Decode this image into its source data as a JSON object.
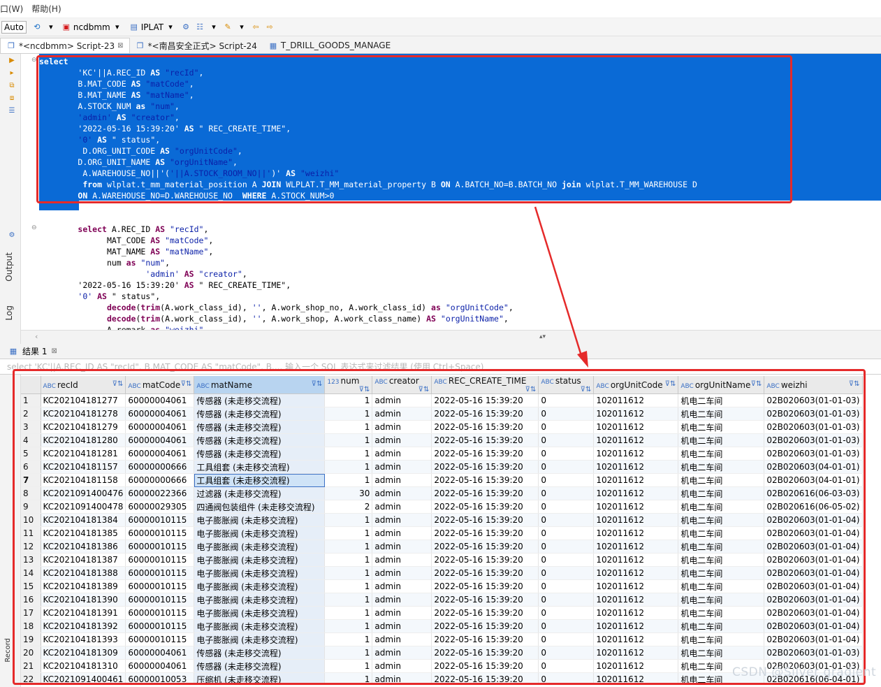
{
  "menu": {
    "window": "口(W)",
    "help": "帮助(H)"
  },
  "toolbar": {
    "auto": "Auto",
    "connection": "ncdbmm",
    "schema": "IPLAT"
  },
  "tabs": [
    {
      "label": "*<ncdbmm> Script-23",
      "close": "⊠"
    },
    {
      "label": "*<南昌安全正式> Script-24",
      "close": ""
    },
    {
      "label": "T_DRILL_GOODS_MANAGE",
      "close": ""
    }
  ],
  "side": {
    "output": "Output",
    "log": "Log",
    "record": "Record"
  },
  "editor": {
    "selected_lines": [
      "select",
      "        'KC'||A.REC_ID AS \"recId\",",
      "        B.MAT_CODE AS \"matCode\",",
      "        B.MAT_NAME AS \"matName\",",
      "        A.STOCK_NUM as \"num\",",
      "        'admin' AS \"creator\",",
      "        '2022-05-16 15:39:20' AS \" REC_CREATE_TIME\",",
      "        '0' AS \" status\",",
      "         D.ORG_UNIT_CODE AS \"orgUnitCode\",",
      "        D.ORG_UNIT_NAME AS \"orgUnitName\",",
      "         A.WAREHOUSE_NO||'('||A.STOCK_ROOM_NO||')' AS \"weizhi\"",
      "         from wlplat.t_mm_material_position A JOIN WLPLAT.T_MM_material_property B ON A.BATCH_NO=B.BATCH_NO join wlplat.T_MM_WAREHOUSE D",
      "        ON A.WAREHOUSE_NO=D.WAREHOUSE_NO  WHERE A.STOCK_NUM>0"
    ],
    "other_lines": [
      "        select A.REC_ID AS \"recId\",",
      "              MAT_CODE AS \"matCode\",",
      "              MAT_NAME AS \"matName\",",
      "              num as \"num\",",
      "                      'admin' AS \"creator\",",
      "        '2022-05-16 15:39:20' AS \" REC_CREATE_TIME\",",
      "        '0' AS \" status\",",
      "              decode(trim(A.work_class_id), '', A.work_shop_no, A.work_class_id) as \"orgUnitCode\",",
      "              decode(trim(A.work_class_id), '', A.work_shop, A.work_class_name) AS \"orgUnitName\",",
      "              A.remark as \"weizhi\""
    ]
  },
  "results": {
    "tab_label": "结果 1",
    "tab_close": "⊠",
    "filter_text": "select 'KC'||A.REC_ID AS \"recId\", B.MAT_CODE AS \"matCode\", B.... 输入一个 SQL 表达式来过滤结果 (使用 Ctrl+Space)",
    "type_icon": "ABC",
    "num_type_icon": "123",
    "columns": [
      "recId",
      "matCode",
      "matName",
      "num",
      "creator",
      "REC_CREATE_TIME",
      "status",
      "orgUnitCode",
      "orgUnitName",
      "weizhi"
    ],
    "rows": [
      [
        "1",
        "KC202104181277",
        "60000004061",
        "传感器 (未走移交流程)",
        "1",
        "admin",
        "2022-05-16 15:39:20",
        "0",
        "102011612",
        "机电二车间",
        "02B020603(01-01-03)"
      ],
      [
        "2",
        "KC202104181278",
        "60000004061",
        "传感器 (未走移交流程)",
        "1",
        "admin",
        "2022-05-16 15:39:20",
        "0",
        "102011612",
        "机电二车间",
        "02B020603(01-01-03)"
      ],
      [
        "3",
        "KC202104181279",
        "60000004061",
        "传感器 (未走移交流程)",
        "1",
        "admin",
        "2022-05-16 15:39:20",
        "0",
        "102011612",
        "机电二车间",
        "02B020603(01-01-03)"
      ],
      [
        "4",
        "KC202104181280",
        "60000004061",
        "传感器 (未走移交流程)",
        "1",
        "admin",
        "2022-05-16 15:39:20",
        "0",
        "102011612",
        "机电二车间",
        "02B020603(01-01-03)"
      ],
      [
        "5",
        "KC202104181281",
        "60000004061",
        "传感器 (未走移交流程)",
        "1",
        "admin",
        "2022-05-16 15:39:20",
        "0",
        "102011612",
        "机电二车间",
        "02B020603(01-01-03)"
      ],
      [
        "6",
        "KC202104181157",
        "60000000666",
        "工具组套 (未走移交流程)",
        "1",
        "admin",
        "2022-05-16 15:39:20",
        "0",
        "102011612",
        "机电二车间",
        "02B020603(04-01-01)"
      ],
      [
        "7",
        "KC202104181158",
        "60000000666",
        "工具组套 (未走移交流程)",
        "1",
        "admin",
        "2022-05-16 15:39:20",
        "0",
        "102011612",
        "机电二车间",
        "02B020603(04-01-01)"
      ],
      [
        "8",
        "KC2021091400476",
        "60000022366",
        "过滤器 (未走移交流程)",
        "30",
        "admin",
        "2022-05-16 15:39:20",
        "0",
        "102011612",
        "机电二车间",
        "02B020616(06-03-03)"
      ],
      [
        "9",
        "KC2021091400478",
        "60000029305",
        "四通阀包装组件 (未走移交流程)",
        "2",
        "admin",
        "2022-05-16 15:39:20",
        "0",
        "102011612",
        "机电二车间",
        "02B020616(06-05-02)"
      ],
      [
        "10",
        "KC202104181384",
        "60000010115",
        "电子膨胀阀 (未走移交流程)",
        "1",
        "admin",
        "2022-05-16 15:39:20",
        "0",
        "102011612",
        "机电二车间",
        "02B020603(01-01-04)"
      ],
      [
        "11",
        "KC202104181385",
        "60000010115",
        "电子膨胀阀 (未走移交流程)",
        "1",
        "admin",
        "2022-05-16 15:39:20",
        "0",
        "102011612",
        "机电二车间",
        "02B020603(01-01-04)"
      ],
      [
        "12",
        "KC202104181386",
        "60000010115",
        "电子膨胀阀 (未走移交流程)",
        "1",
        "admin",
        "2022-05-16 15:39:20",
        "0",
        "102011612",
        "机电二车间",
        "02B020603(01-01-04)"
      ],
      [
        "13",
        "KC202104181387",
        "60000010115",
        "电子膨胀阀 (未走移交流程)",
        "1",
        "admin",
        "2022-05-16 15:39:20",
        "0",
        "102011612",
        "机电二车间",
        "02B020603(01-01-04)"
      ],
      [
        "14",
        "KC202104181388",
        "60000010115",
        "电子膨胀阀 (未走移交流程)",
        "1",
        "admin",
        "2022-05-16 15:39:20",
        "0",
        "102011612",
        "机电二车间",
        "02B020603(01-01-04)"
      ],
      [
        "15",
        "KC202104181389",
        "60000010115",
        "电子膨胀阀 (未走移交流程)",
        "1",
        "admin",
        "2022-05-16 15:39:20",
        "0",
        "102011612",
        "机电二车间",
        "02B020603(01-01-04)"
      ],
      [
        "16",
        "KC202104181390",
        "60000010115",
        "电子膨胀阀 (未走移交流程)",
        "1",
        "admin",
        "2022-05-16 15:39:20",
        "0",
        "102011612",
        "机电二车间",
        "02B020603(01-01-04)"
      ],
      [
        "17",
        "KC202104181391",
        "60000010115",
        "电子膨胀阀 (未走移交流程)",
        "1",
        "admin",
        "2022-05-16 15:39:20",
        "0",
        "102011612",
        "机电二车间",
        "02B020603(01-01-04)"
      ],
      [
        "18",
        "KC202104181392",
        "60000010115",
        "电子膨胀阀 (未走移交流程)",
        "1",
        "admin",
        "2022-05-16 15:39:20",
        "0",
        "102011612",
        "机电二车间",
        "02B020603(01-01-04)"
      ],
      [
        "19",
        "KC202104181393",
        "60000010115",
        "电子膨胀阀 (未走移交流程)",
        "1",
        "admin",
        "2022-05-16 15:39:20",
        "0",
        "102011612",
        "机电二车间",
        "02B020603(01-01-04)"
      ],
      [
        "20",
        "KC202104181309",
        "60000004061",
        "传感器 (未走移交流程)",
        "1",
        "admin",
        "2022-05-16 15:39:20",
        "0",
        "102011612",
        "机电二车间",
        "02B020603(01-01-03)"
      ],
      [
        "21",
        "KC202104181310",
        "60000004061",
        "传感器 (未走移交流程)",
        "1",
        "admin",
        "2022-05-16 15:39:20",
        "0",
        "102011612",
        "机电二车间",
        "02B020603(01-01-03)"
      ],
      [
        "22",
        "KC2021091400461",
        "60000010053",
        "压缩机 (未走移交流程)",
        "1",
        "admin",
        "2022-05-16 15:39:20",
        "0",
        "102011612",
        "机电二车间",
        "02B020616(06-04-01)"
      ]
    ],
    "selected_row": "7"
  },
  "watermark": "CSDN @Silver gradient",
  "colors": {
    "selection": "#0a6ad6",
    "annotation": "#e52a2a",
    "keyword": "#7f0055"
  }
}
